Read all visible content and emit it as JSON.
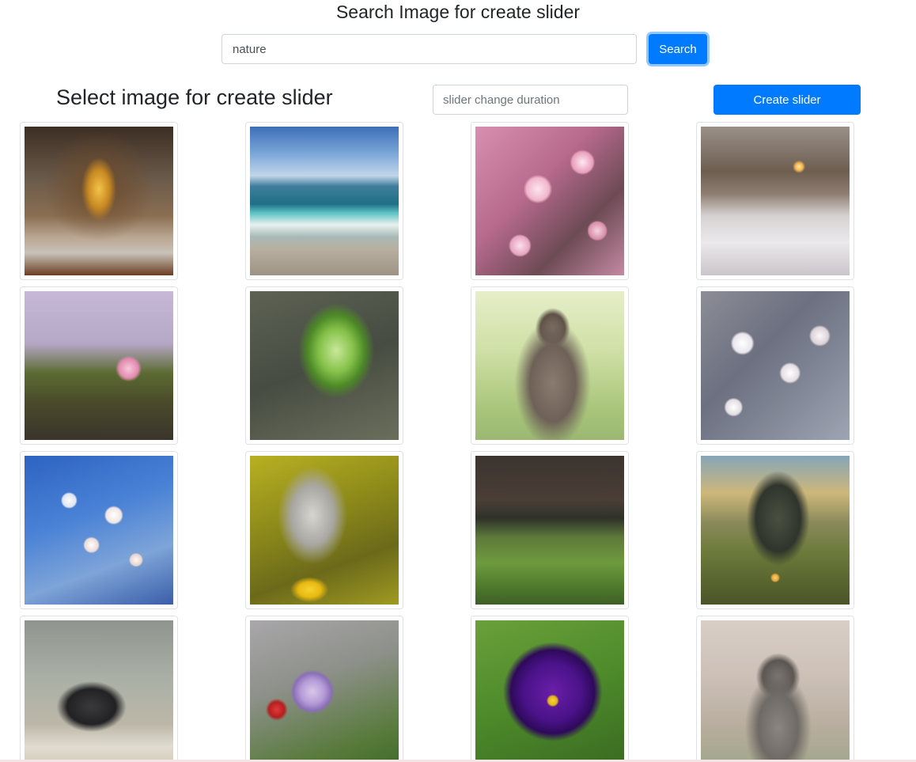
{
  "header": {
    "title": "Search Image for create slider",
    "search_value": "nature",
    "search_button": "Search"
  },
  "toolbar": {
    "title": "Select image for create slider",
    "duration_placeholder": "slider change duration",
    "create_button": "Create slider"
  },
  "images": [
    {
      "subject": "chapel altar"
    },
    {
      "subject": "sea wave beach"
    },
    {
      "subject": "pink cherry blossom"
    },
    {
      "subject": "snowy forest path"
    },
    {
      "subject": "pink flower on moss"
    },
    {
      "subject": "fern frond"
    },
    {
      "subject": "wallaby"
    },
    {
      "subject": "white blossoms"
    },
    {
      "subject": "blossom branch blue sky"
    },
    {
      "subject": "blue butterfly"
    },
    {
      "subject": "green valley village"
    },
    {
      "subject": "mountain landscape"
    },
    {
      "subject": "beetle on rock"
    },
    {
      "subject": "anemone flower"
    },
    {
      "subject": "purple pansy"
    },
    {
      "subject": "wallaby portrait"
    }
  ]
}
